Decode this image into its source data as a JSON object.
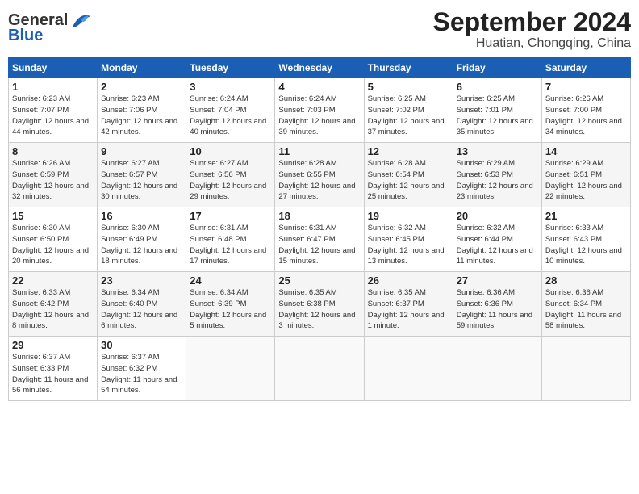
{
  "header": {
    "logo_line1": "General",
    "logo_line2": "Blue",
    "month": "September 2024",
    "location": "Huatian, Chongqing, China"
  },
  "weekdays": [
    "Sunday",
    "Monday",
    "Tuesday",
    "Wednesday",
    "Thursday",
    "Friday",
    "Saturday"
  ],
  "weeks": [
    [
      {
        "day": "1",
        "sunrise": "6:23 AM",
        "sunset": "7:07 PM",
        "daylight": "12 hours and 44 minutes."
      },
      {
        "day": "2",
        "sunrise": "6:23 AM",
        "sunset": "7:06 PM",
        "daylight": "12 hours and 42 minutes."
      },
      {
        "day": "3",
        "sunrise": "6:24 AM",
        "sunset": "7:04 PM",
        "daylight": "12 hours and 40 minutes."
      },
      {
        "day": "4",
        "sunrise": "6:24 AM",
        "sunset": "7:03 PM",
        "daylight": "12 hours and 39 minutes."
      },
      {
        "day": "5",
        "sunrise": "6:25 AM",
        "sunset": "7:02 PM",
        "daylight": "12 hours and 37 minutes."
      },
      {
        "day": "6",
        "sunrise": "6:25 AM",
        "sunset": "7:01 PM",
        "daylight": "12 hours and 35 minutes."
      },
      {
        "day": "7",
        "sunrise": "6:26 AM",
        "sunset": "7:00 PM",
        "daylight": "12 hours and 34 minutes."
      }
    ],
    [
      {
        "day": "8",
        "sunrise": "6:26 AM",
        "sunset": "6:59 PM",
        "daylight": "12 hours and 32 minutes."
      },
      {
        "day": "9",
        "sunrise": "6:27 AM",
        "sunset": "6:57 PM",
        "daylight": "12 hours and 30 minutes."
      },
      {
        "day": "10",
        "sunrise": "6:27 AM",
        "sunset": "6:56 PM",
        "daylight": "12 hours and 29 minutes."
      },
      {
        "day": "11",
        "sunrise": "6:28 AM",
        "sunset": "6:55 PM",
        "daylight": "12 hours and 27 minutes."
      },
      {
        "day": "12",
        "sunrise": "6:28 AM",
        "sunset": "6:54 PM",
        "daylight": "12 hours and 25 minutes."
      },
      {
        "day": "13",
        "sunrise": "6:29 AM",
        "sunset": "6:53 PM",
        "daylight": "12 hours and 23 minutes."
      },
      {
        "day": "14",
        "sunrise": "6:29 AM",
        "sunset": "6:51 PM",
        "daylight": "12 hours and 22 minutes."
      }
    ],
    [
      {
        "day": "15",
        "sunrise": "6:30 AM",
        "sunset": "6:50 PM",
        "daylight": "12 hours and 20 minutes."
      },
      {
        "day": "16",
        "sunrise": "6:30 AM",
        "sunset": "6:49 PM",
        "daylight": "12 hours and 18 minutes."
      },
      {
        "day": "17",
        "sunrise": "6:31 AM",
        "sunset": "6:48 PM",
        "daylight": "12 hours and 17 minutes."
      },
      {
        "day": "18",
        "sunrise": "6:31 AM",
        "sunset": "6:47 PM",
        "daylight": "12 hours and 15 minutes."
      },
      {
        "day": "19",
        "sunrise": "6:32 AM",
        "sunset": "6:45 PM",
        "daylight": "12 hours and 13 minutes."
      },
      {
        "day": "20",
        "sunrise": "6:32 AM",
        "sunset": "6:44 PM",
        "daylight": "12 hours and 11 minutes."
      },
      {
        "day": "21",
        "sunrise": "6:33 AM",
        "sunset": "6:43 PM",
        "daylight": "12 hours and 10 minutes."
      }
    ],
    [
      {
        "day": "22",
        "sunrise": "6:33 AM",
        "sunset": "6:42 PM",
        "daylight": "12 hours and 8 minutes."
      },
      {
        "day": "23",
        "sunrise": "6:34 AM",
        "sunset": "6:40 PM",
        "daylight": "12 hours and 6 minutes."
      },
      {
        "day": "24",
        "sunrise": "6:34 AM",
        "sunset": "6:39 PM",
        "daylight": "12 hours and 5 minutes."
      },
      {
        "day": "25",
        "sunrise": "6:35 AM",
        "sunset": "6:38 PM",
        "daylight": "12 hours and 3 minutes."
      },
      {
        "day": "26",
        "sunrise": "6:35 AM",
        "sunset": "6:37 PM",
        "daylight": "12 hours and 1 minute."
      },
      {
        "day": "27",
        "sunrise": "6:36 AM",
        "sunset": "6:36 PM",
        "daylight": "11 hours and 59 minutes."
      },
      {
        "day": "28",
        "sunrise": "6:36 AM",
        "sunset": "6:34 PM",
        "daylight": "11 hours and 58 minutes."
      }
    ],
    [
      {
        "day": "29",
        "sunrise": "6:37 AM",
        "sunset": "6:33 PM",
        "daylight": "11 hours and 56 minutes."
      },
      {
        "day": "30",
        "sunrise": "6:37 AM",
        "sunset": "6:32 PM",
        "daylight": "11 hours and 54 minutes."
      },
      null,
      null,
      null,
      null,
      null
    ]
  ]
}
